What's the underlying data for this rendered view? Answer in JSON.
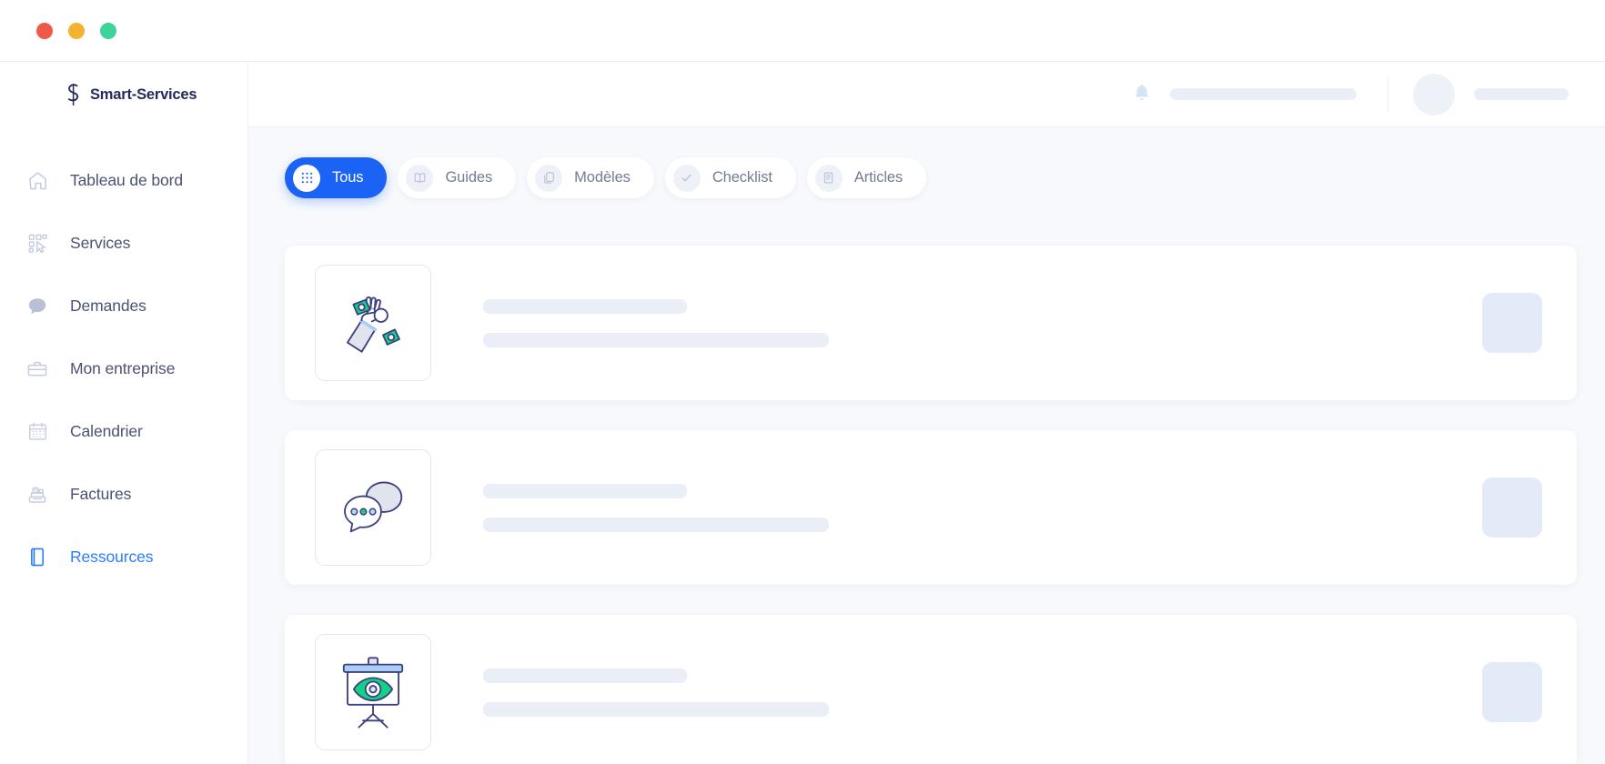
{
  "window": {
    "traffic_lights": [
      {
        "name": "close-button",
        "color": "#ee5a47"
      },
      {
        "name": "minimize-button",
        "color": "#f3b32e"
      },
      {
        "name": "maximize-button",
        "color": "#3ed39a"
      }
    ]
  },
  "brand": {
    "name": "Smart-Services",
    "logo_icon": "smart-services-s-logo",
    "color": "#252a5e"
  },
  "sidebar": {
    "items": [
      {
        "label": "Tableau de bord",
        "icon": "home-icon",
        "active": false
      },
      {
        "label": "Services",
        "icon": "grid-cursor-icon",
        "active": false
      },
      {
        "label": "Demandes",
        "icon": "chat-bubble-icon",
        "active": false
      },
      {
        "label": "Mon entreprise",
        "icon": "briefcase-icon",
        "active": false
      },
      {
        "label": "Calendrier",
        "icon": "calendar-icon",
        "active": false
      },
      {
        "label": "Factures",
        "icon": "cash-register-icon",
        "active": false
      },
      {
        "label": "Ressources",
        "icon": "book-icon",
        "active": true
      }
    ],
    "active_color": "#2b7cff",
    "inactive_color": "#4b5272"
  },
  "topbar": {
    "notification_icon": "bell-icon",
    "search_placeholder_skeleton": "",
    "avatar_icon": "avatar",
    "name_skeleton": ""
  },
  "tabs": {
    "accent_color": "#1a63f5",
    "items": [
      {
        "label": "Tous",
        "icon": "grid-dots-icon",
        "active": true
      },
      {
        "label": "Guides",
        "icon": "book-open-icon",
        "active": false
      },
      {
        "label": "Modèles",
        "icon": "copy-icon",
        "active": false
      },
      {
        "label": "Checklist",
        "icon": "check-icon",
        "active": false
      },
      {
        "label": "Articles",
        "icon": "article-icon",
        "active": false
      }
    ]
  },
  "cards": [
    {
      "illustration": "hand-ok-money-illustration",
      "title_skeleton": "",
      "subtitle_skeleton": "",
      "action_skeleton": ""
    },
    {
      "illustration": "chat-bubbles-illustration",
      "title_skeleton": "",
      "subtitle_skeleton": "",
      "action_skeleton": ""
    },
    {
      "illustration": "presentation-eye-illustration",
      "title_skeleton": "",
      "subtitle_skeleton": "",
      "action_skeleton": ""
    }
  ],
  "palette": {
    "page_bg": "#f7f9fc",
    "card_bg": "#ffffff",
    "skeleton": "#eaeef6",
    "skeleton_strong": "#e2ebf7",
    "illustration_ink": "#3c4080",
    "illustration_green": "#12d385",
    "illustration_blue": "#a9cdf4",
    "illustration_grey": "#dfe2ea"
  }
}
